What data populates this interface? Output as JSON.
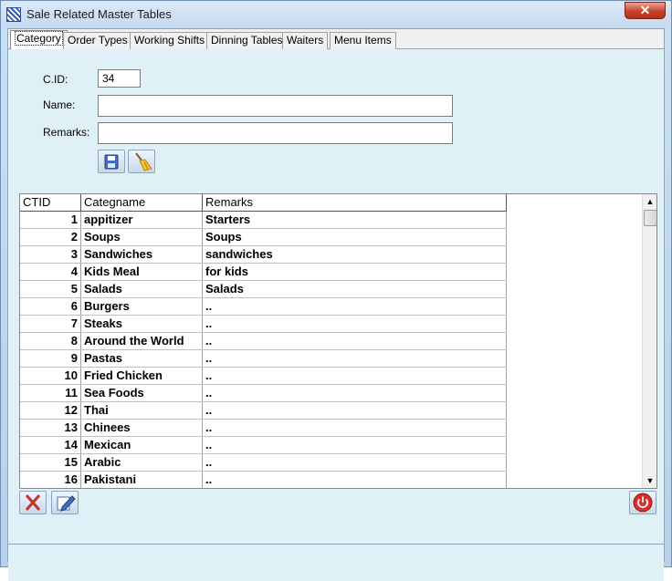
{
  "window": {
    "title": "Sale Related Master Tables",
    "close_label": "✕"
  },
  "tabs": [
    {
      "label": "Category"
    },
    {
      "label": "Order Types"
    },
    {
      "label": "Working Shifts"
    },
    {
      "label": "Dinning Tables"
    },
    {
      "label": "Waiters"
    },
    {
      "label": "Menu Items"
    }
  ],
  "form": {
    "cid_label": "C.ID:",
    "cid_value": "34",
    "name_label": "Name:",
    "name_value": "",
    "remarks_label": "Remarks:",
    "remarks_value": ""
  },
  "icons": {
    "save": "save-icon",
    "clear": "broom-icon",
    "delete": "delete-x-icon",
    "edit": "edit-pencil-icon",
    "exit": "power-icon"
  },
  "grid": {
    "columns": [
      "CTID",
      "Categname",
      "Remarks"
    ],
    "rows": [
      {
        "id": "1",
        "name": "appitizer",
        "remarks": "Starters"
      },
      {
        "id": "2",
        "name": "Soups",
        "remarks": "Soups"
      },
      {
        "id": "3",
        "name": "Sandwiches",
        "remarks": "sandwiches"
      },
      {
        "id": "4",
        "name": "Kids Meal",
        "remarks": "for kids"
      },
      {
        "id": "5",
        "name": "Salads",
        "remarks": "Salads"
      },
      {
        "id": "6",
        "name": "Burgers",
        "remarks": ".."
      },
      {
        "id": "7",
        "name": "Steaks",
        "remarks": ".."
      },
      {
        "id": "8",
        "name": "Around the World",
        "remarks": ".."
      },
      {
        "id": "9",
        "name": "Pastas",
        "remarks": ".."
      },
      {
        "id": "10",
        "name": "Fried Chicken",
        "remarks": ".."
      },
      {
        "id": "11",
        "name": "Sea Foods",
        "remarks": ".."
      },
      {
        "id": "12",
        "name": "Thai",
        "remarks": ".."
      },
      {
        "id": "13",
        "name": "Chinees",
        "remarks": ".."
      },
      {
        "id": "14",
        "name": "Mexican",
        "remarks": ".."
      },
      {
        "id": "15",
        "name": "Arabic",
        "remarks": ".."
      },
      {
        "id": "16",
        "name": "Pakistani",
        "remarks": ".."
      }
    ]
  },
  "colors": {
    "content_bg": "#dff0f7",
    "close_red": "#c7432b",
    "power_red": "#d9302b"
  }
}
